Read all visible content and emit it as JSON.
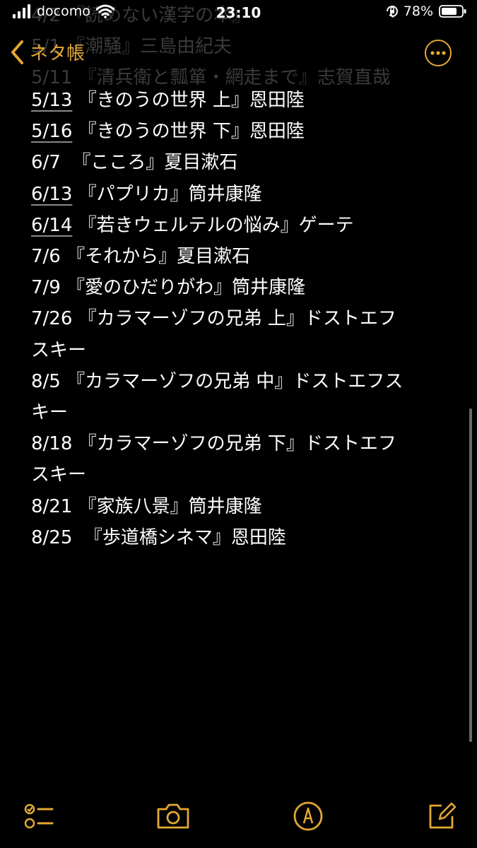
{
  "status_bar": {
    "carrier": "docomo",
    "time": "23:10",
    "battery_percent": "78%"
  },
  "nav": {
    "back_label": "ネタ帳"
  },
  "ghost_lines": [
    "4/2 『読めない漢字の本』",
    "5/1 『潮騒』三島由紀夫",
    "5/11 『清兵衛と瓢箪・網走まで』志賀直哉"
  ],
  "entries": [
    {
      "date": "5/13",
      "text": " 『きのうの世界 上』恩田陸",
      "linked": true
    },
    {
      "date": "5/16",
      "text": " 『きのうの世界 下』恩田陸",
      "linked": true
    },
    {
      "date": "6/7",
      "text": "  『こころ』夏目漱石",
      "linked": false
    },
    {
      "date": "6/13",
      "text": " 『パプリカ』筒井康隆",
      "linked": true
    },
    {
      "date": "6/14",
      "text": " 『若きウェルテルの悩み』ゲーテ",
      "linked": true
    },
    {
      "date": "7/6",
      "text": " 『それから』夏目漱石",
      "linked": false
    },
    {
      "date": "7/9",
      "text": " 『愛のひだりがわ』筒井康隆",
      "linked": false
    },
    {
      "date": "7/26",
      "text": " 『カラマーゾフの兄弟 上』ドストエフ",
      "linked": false
    },
    {
      "date": "",
      "text": "スキー",
      "linked": false
    },
    {
      "date": "8/5",
      "text": " 『カラマーゾフの兄弟 中』ドストエフス",
      "linked": false
    },
    {
      "date": "",
      "text": "キー",
      "linked": false
    },
    {
      "date": "8/18",
      "text": " 『カラマーゾフの兄弟 下』ドストエフ",
      "linked": false
    },
    {
      "date": "",
      "text": "スキー",
      "linked": false
    },
    {
      "date": "8/21",
      "text": " 『家族八景』筒井康隆",
      "linked": false
    },
    {
      "date": "8/25",
      "text": "  『歩道橋シネマ』恩田陸",
      "linked": false
    }
  ],
  "colors": {
    "accent": "#e3a834",
    "background": "#000000",
    "text": "#ffffff"
  },
  "toolbar": {
    "icons": [
      "checklist-icon",
      "camera-icon",
      "markup-pen-icon",
      "compose-icon"
    ]
  }
}
